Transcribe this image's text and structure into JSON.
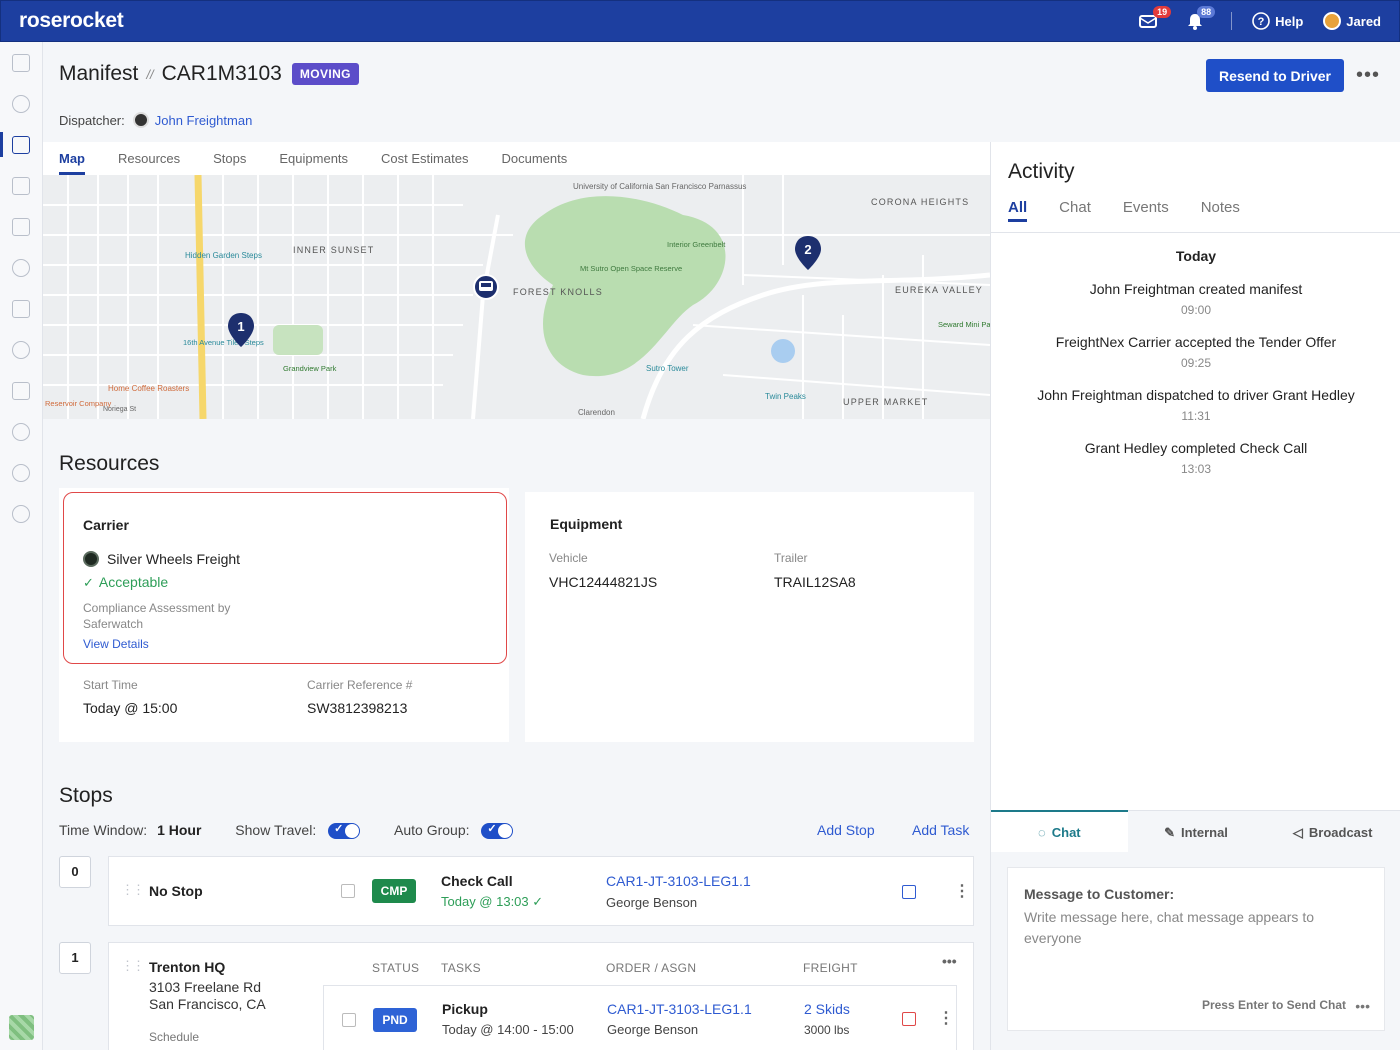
{
  "app": {
    "logo": "roserocket"
  },
  "topbar": {
    "mail_badge": "19",
    "bell_badge": "88",
    "help_label": "Help",
    "user_name": "Jared"
  },
  "header": {
    "title": "Manifest",
    "separator": "//",
    "manifest_id": "CAR1M3103",
    "status": "MOVING",
    "resend_label": "Resend to Driver",
    "more_label": "•••",
    "dispatcher_label": "Dispatcher:",
    "dispatcher_name": "John Freightman"
  },
  "tabs": [
    "Map",
    "Resources",
    "Stops",
    "Equipments",
    "Cost Estimates",
    "Documents"
  ],
  "map": {
    "labels": {
      "university": "University of California San Francisco Parnassus",
      "inner_sunset": "INNER SUNSET",
      "forest_knolls": "FOREST KNOLLS",
      "corona_heights": "CORONA HEIGHTS",
      "eureka_valley": "EUREKA VALLEY",
      "upper_market": "UPPER MARKET",
      "hidden_garden": "Hidden Garden Steps",
      "grandview": "Grandview Park",
      "home_coffee": "Home Coffee Roasters",
      "reservoir": "Reservoir Company",
      "sutro_tower": "Sutro Tower",
      "twin_peaks": "Twin Peaks",
      "seward": "Seward Mini Park",
      "mt_sutro": "Mt Sutro Open Space Reserve",
      "interior_greenbelt": "Interior Greenbelt",
      "clarendon": "Clarendon",
      "sixteenth_ave": "16th Avenue Tiled Steps",
      "noriega": "Noriega St"
    },
    "pin1": "1",
    "pin2": "2"
  },
  "resources": {
    "title": "Resources",
    "carrier": {
      "heading": "Carrier",
      "name": "Silver Wheels Freight",
      "status": "Acceptable",
      "compliance": "Compliance Assessment by Saferwatch",
      "view_details": "View Details",
      "start_time_label": "Start Time",
      "start_time": "Today @ 15:00",
      "ref_label": "Carrier Reference #",
      "ref": "SW3812398213"
    },
    "equipment": {
      "heading": "Equipment",
      "vehicle_label": "Vehicle",
      "vehicle": "VHC12444821JS",
      "trailer_label": "Trailer",
      "trailer": "TRAIL12SA8"
    }
  },
  "stops": {
    "title": "Stops",
    "time_window_label": "Time Window:",
    "time_window": "1 Hour",
    "show_travel_label": "Show Travel:",
    "auto_group_label": "Auto Group:",
    "add_stop": "Add Stop",
    "add_task": "Add Task",
    "items": [
      {
        "num": "0",
        "name": "No Stop",
        "status": "CMP",
        "task": "Check Call",
        "task_time": "Today @ 13:03",
        "order": "CAR1-JT-3103-LEG1.1",
        "assignee": "George Benson"
      },
      {
        "num": "1",
        "name": "Trenton HQ",
        "address1": "3103 Freelane Rd",
        "address2": "San Francisco, CA",
        "schedule": "Schedule",
        "col_status": "STATUS",
        "col_tasks": "TASKS",
        "col_order": "ORDER / ASGN",
        "col_freight": "FREIGHT",
        "status": "PND",
        "task": "Pickup",
        "task_time": "Today @ 14:00 - 15:00",
        "order": "CAR1-JT-3103-LEG1.1",
        "assignee": "George Benson",
        "freight": "2 Skids",
        "weight": "3000 lbs"
      }
    ]
  },
  "activity": {
    "title": "Activity",
    "tabs": [
      "All",
      "Chat",
      "Events",
      "Notes"
    ],
    "day": "Today",
    "entries": [
      {
        "text": "John Freightman created manifest",
        "time": "09:00"
      },
      {
        "text": "FreightNex Carrier accepted the Tender Offer",
        "time": "09:25"
      },
      {
        "text": "John Freightman dispatched to driver Grant Hedley",
        "time": "11:31"
      },
      {
        "text": "Grant Hedley completed Check Call",
        "time": "13:03"
      }
    ]
  },
  "chat": {
    "tabs": [
      "Chat",
      "Internal",
      "Broadcast"
    ],
    "label": "Message to Customer:",
    "placeholder": "Write message here, chat message appears to everyone",
    "send_hint": "Press Enter to Send Chat",
    "more": "•••"
  },
  "colors": {
    "brand": "#1d3fa0",
    "status_moving": "#5c4dc9",
    "status_cmp": "#1e8a4c",
    "status_pnd": "#2e63d6",
    "acceptable": "#2e9e58",
    "highlight_border": "#e04848"
  }
}
